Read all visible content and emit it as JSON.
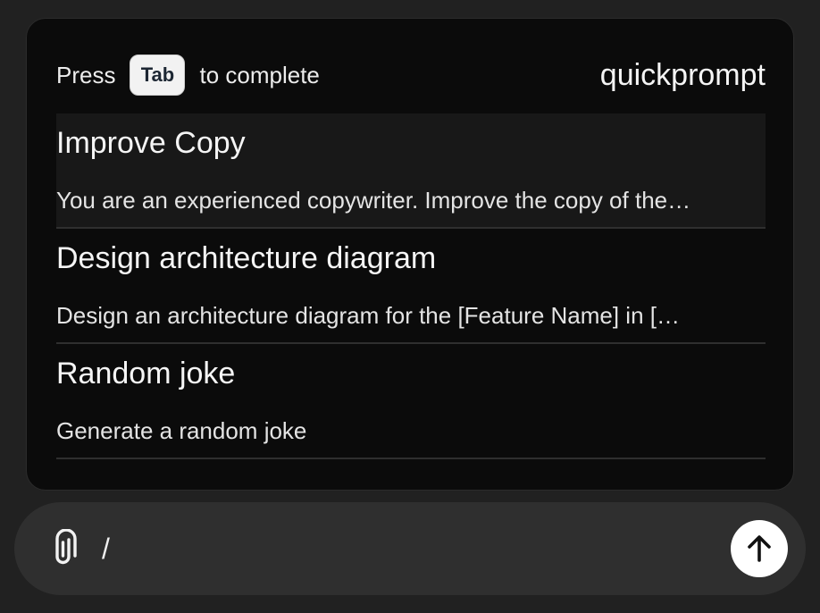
{
  "popup": {
    "hint_before": "Press",
    "hint_key": "Tab",
    "hint_after": "to complete",
    "brand": "quickprompt",
    "items": [
      {
        "title": "Improve Copy",
        "description": "You are an experienced copywriter. Improve the copy of the…",
        "selected": true
      },
      {
        "title": "Design architecture diagram",
        "description": "Design an architecture diagram for the [Feature Name] in […",
        "selected": false
      },
      {
        "title": "Random joke",
        "description": "Generate a random joke",
        "selected": false
      }
    ]
  },
  "composer": {
    "value": "/",
    "attach_icon": "paperclip-icon",
    "send_icon": "arrow-up-icon"
  },
  "colors": {
    "page_background": "#212121",
    "popup_background": "#0b0b0b",
    "selected_item_background": "#181818",
    "composer_background": "#2f2f2f",
    "send_button": "#ffffff"
  }
}
